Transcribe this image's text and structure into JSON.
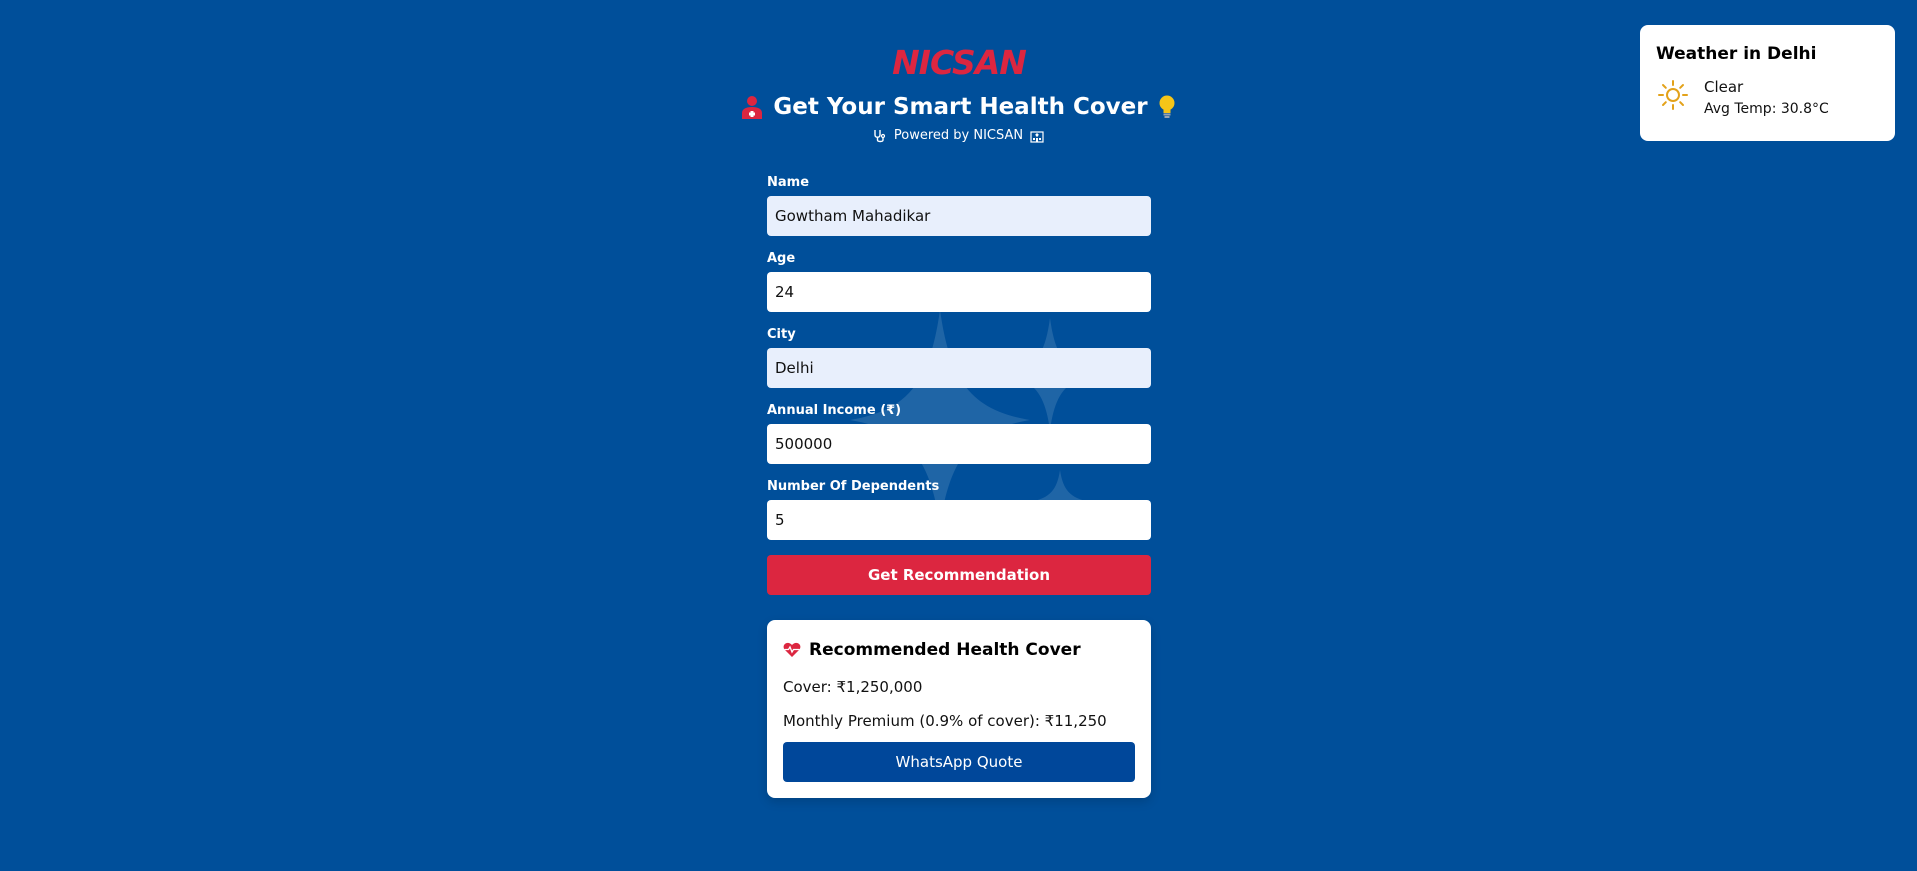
{
  "brand": {
    "logo_text": "NICSAN",
    "accent": "#dc2640",
    "background": "#004f9a"
  },
  "header": {
    "title": "Get Your Smart Health Cover",
    "subtitle": "Powered by NICSAN",
    "icons": [
      "doctor-icon",
      "lightbulb-icon",
      "stethoscope-icon",
      "hospital-icon"
    ]
  },
  "form": {
    "fields": [
      {
        "label": "Name",
        "value": "Gowtham Mahadikar"
      },
      {
        "label": "Age",
        "value": "24"
      },
      {
        "label": "City",
        "value": "Delhi"
      },
      {
        "label": "Annual Income (₹)",
        "value": "500000"
      },
      {
        "label": "Number Of Dependents",
        "value": "5"
      }
    ],
    "submit_label": "Get Recommendation"
  },
  "result": {
    "title": "Recommended Health Cover",
    "cover_text": "Cover: ₹1,250,000",
    "premium_text": "Monthly Premium (0.9% of cover): ₹11,250",
    "whatsapp_label": "WhatsApp Quote"
  },
  "weather": {
    "title": "Weather in Delhi",
    "condition": "Clear",
    "avg_temp": "Avg Temp: 30.8°C",
    "icon": "sun-icon"
  }
}
